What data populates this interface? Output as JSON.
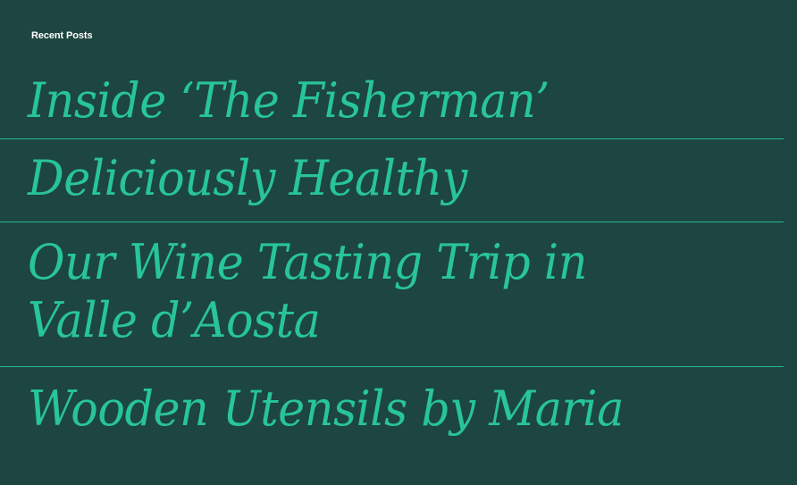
{
  "widget": {
    "title": "Recent Posts"
  },
  "posts": [
    {
      "title": "Inside ‘The Fisherman’"
    },
    {
      "title": "Deliciously Healthy"
    },
    {
      "title": "Our Wine Tasting Trip in Valle d’Aosta"
    },
    {
      "title": "Wooden Utensils by Maria"
    }
  ],
  "colors": {
    "background": "#1d4541",
    "accent": "#28c596",
    "divider": "#2ab88d",
    "heading": "#ffffff"
  }
}
